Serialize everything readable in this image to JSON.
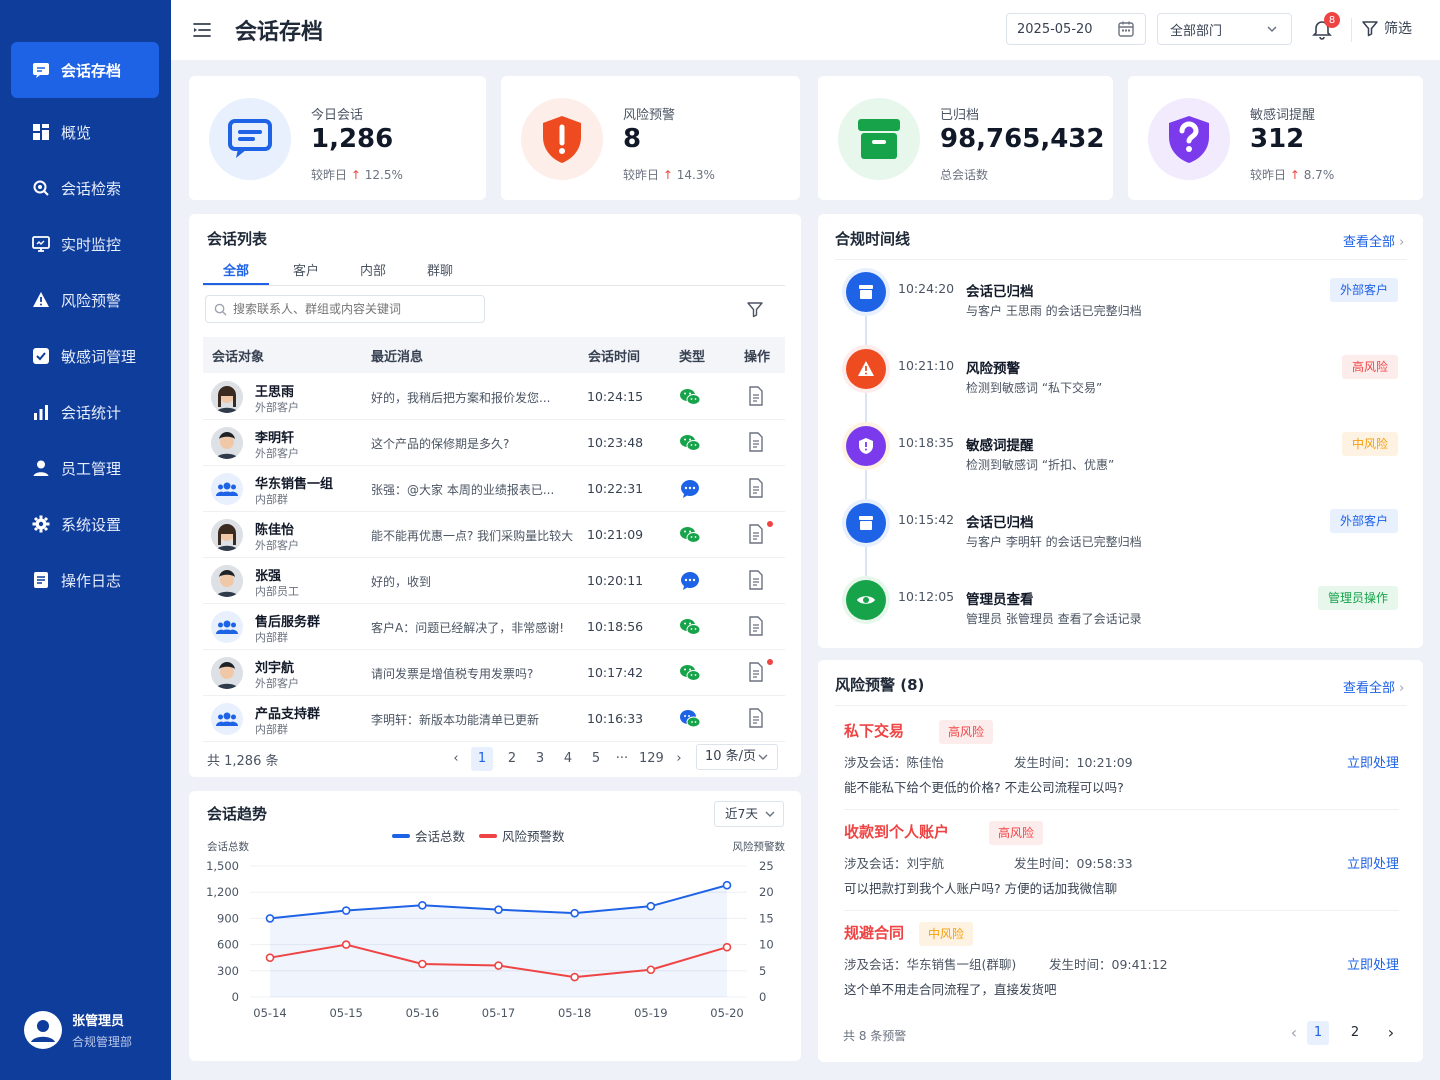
{
  "app": {
    "title": "会话存档"
  },
  "sidebar": {
    "items": [
      {
        "label": "会话存档",
        "icon": "chat-icon"
      },
      {
        "label": "概览",
        "icon": "dashboard-icon"
      },
      {
        "label": "会话检索",
        "icon": "search-icon"
      },
      {
        "label": "实时监控",
        "icon": "monitor-icon"
      },
      {
        "label": "风险预警",
        "icon": "alert-icon"
      },
      {
        "label": "敏感词管理",
        "icon": "check-icon"
      },
      {
        "label": "会话统计",
        "icon": "bar-chart-icon"
      },
      {
        "label": "员工管理",
        "icon": "user-icon"
      },
      {
        "label": "系统设置",
        "icon": "gear-icon"
      },
      {
        "label": "操作日志",
        "icon": "log-icon"
      }
    ],
    "active": 0,
    "user": {
      "name": "张管理员",
      "dept": "合规管理部"
    }
  },
  "topbar": {
    "date": "2025-05-20",
    "dept": "全部部门",
    "notifications": "8",
    "filter_label": "筛选"
  },
  "stats": [
    {
      "label": "今日会话",
      "value": "1,286",
      "prefix": "较昨日",
      "change": "12.5%",
      "color": "#1e62e6",
      "bg": "#e8f0fe",
      "icon": "chat-icon"
    },
    {
      "label": "风险预警",
      "value": "8",
      "prefix": "较昨日",
      "change": "14.3%",
      "color": "#ef4b21",
      "bg": "#feeee9",
      "icon": "shield-alert-icon"
    },
    {
      "label": "已归档",
      "value": "98,765,432",
      "prefix": "总会话数",
      "change": "",
      "color": "#16a34a",
      "bg": "#e7f7ec",
      "icon": "archive-icon"
    },
    {
      "label": "敏感词提醒",
      "value": "312",
      "prefix": "较昨日",
      "change": "8.7%",
      "color": "#7c3aed",
      "bg": "#f1ebfd",
      "icon": "shield-warn-icon"
    }
  ],
  "session_list": {
    "title": "会话列表",
    "tabs": [
      "全部",
      "客户",
      "内部",
      "群聊"
    ],
    "search_placeholder": "搜索联系人、群组或内容关键词",
    "columns": [
      "会话对象",
      "最近消息",
      "会话时间",
      "类型",
      "操作"
    ],
    "rows": [
      {
        "name": "王思雨",
        "sub": "外部客户",
        "msg": "好的，我稍后把方案和报价发您...",
        "time": "10:24:15",
        "type": "wechat",
        "avatar": "female",
        "dot": false
      },
      {
        "name": "李明轩",
        "sub": "外部客户",
        "msg": "这个产品的保修期是多久?",
        "time": "10:23:48",
        "type": "wechat",
        "avatar": "male",
        "dot": false
      },
      {
        "name": "华东销售一组",
        "sub": "内部群",
        "msg": "张强：@大家 本周的业绩报表已...",
        "time": "10:22:31",
        "type": "internal",
        "avatar": "group",
        "dot": false
      },
      {
        "name": "陈佳怡",
        "sub": "外部客户",
        "msg": "能不能再优惠一点? 我们采购量比较大",
        "time": "10:21:09",
        "type": "wechat",
        "avatar": "female",
        "dot": true
      },
      {
        "name": "张强",
        "sub": "内部员工",
        "msg": "好的，收到",
        "time": "10:20:11",
        "type": "internal",
        "avatar": "male",
        "dot": false
      },
      {
        "name": "售后服务群",
        "sub": "内部群",
        "msg": "客户A：问题已经解决了，非常感谢!",
        "time": "10:18:56",
        "type": "wechat",
        "avatar": "group",
        "dot": false
      },
      {
        "name": "刘宇航",
        "sub": "外部客户",
        "msg": "请问发票是增值税专用发票吗?",
        "time": "10:17:42",
        "type": "wechat",
        "avatar": "male",
        "dot": true
      },
      {
        "name": "产品支持群",
        "sub": "内部群",
        "msg": "李明轩：新版本功能清单已更新",
        "time": "10:16:33",
        "type": "mixed",
        "avatar": "group",
        "dot": false
      }
    ],
    "total": "共 1,286 条",
    "pages": [
      "1",
      "2",
      "3",
      "4",
      "5",
      "···",
      "129"
    ],
    "current_page": "1",
    "page_size": "10 条/页"
  },
  "timeline": {
    "title": "合规时间线",
    "view_all": "查看全部",
    "items": [
      {
        "time": "10:24:20",
        "title": "会话已归档",
        "desc": "与客户 王思雨 的会话已完整归档",
        "tag": "外部客户",
        "color": "#1e62e6",
        "tag_bg": "#e8f0fe",
        "icon": "archive-icon"
      },
      {
        "time": "10:21:10",
        "title": "风险预警",
        "desc": "检测到敏感词 “私下交易”",
        "tag": "高风险",
        "color": "#ef4b21",
        "tag_bg": "#fdecec",
        "icon": "alert-icon"
      },
      {
        "time": "10:18:35",
        "title": "敏感词提醒",
        "desc": "检测到敏感词 “折扣、优惠”",
        "tag": "中风险",
        "color": "#7c3aed",
        "tag_bg": "#fef3e2",
        "icon": "shield-icon"
      },
      {
        "time": "10:15:42",
        "title": "会话已归档",
        "desc": "与客户 李明轩 的会话已完整归档",
        "tag": "外部客户",
        "color": "#1e62e6",
        "tag_bg": "#e8f0fe",
        "icon": "archive-icon"
      },
      {
        "time": "10:12:05",
        "title": "管理员查看",
        "desc": "管理员 张管理员 查看了会话记录",
        "tag": "管理员操作",
        "color": "#16a34a",
        "tag_bg": "#e7f7ec",
        "icon": "eye-icon"
      }
    ]
  },
  "risk_alerts": {
    "title": "风险预警 (8)",
    "view_all": "查看全部",
    "items": [
      {
        "title": "私下交易",
        "level": "高风险",
        "session_label": "涉及会话：陈佳怡",
        "time_label": "发生时间：10:21:09",
        "content": "能不能私下给个更低的价格? 不走公司流程可以吗?",
        "action": "立即处理"
      },
      {
        "title": "收款到个人账户",
        "level": "高风险",
        "session_label": "涉及会话：刘宇航",
        "time_label": "发生时间：09:58:33",
        "content": "可以把款打到我个人账户吗? 方便的话加我微信聊",
        "action": "立即处理"
      },
      {
        "title": "规避合同",
        "level": "中风险",
        "session_label": "涉及会话：华东销售一组(群聊)",
        "time_label": "发生时间：09:41:12",
        "content": "这个单不用走合同流程了，直接发货吧",
        "action": "立即处理"
      }
    ],
    "footer": "共 8 条预警",
    "pages": [
      "1",
      "2"
    ],
    "current_page": "1"
  },
  "trend": {
    "title": "会话趋势",
    "range": "近7天",
    "chart_data": {
      "type": "line",
      "x": [
        "05-14",
        "05-15",
        "05-16",
        "05-17",
        "05-18",
        "05-19",
        "05-20"
      ],
      "series": [
        {
          "name": "会话总数",
          "values": [
            900,
            990,
            1050,
            1000,
            960,
            1040,
            1280
          ],
          "axis": "left",
          "color": "#1e62e6"
        },
        {
          "name": "风险预警数",
          "values": [
            7.5,
            10,
            6.3,
            6,
            3.8,
            5.2,
            9.5
          ],
          "axis": "right",
          "color": "#ef4444"
        }
      ],
      "ylabel_left": "会话总数",
      "ylabel_right": "风险预警数",
      "ylim_left": [
        0,
        1500
      ],
      "ylim_right": [
        0,
        25
      ],
      "yticks_left": [
        "0",
        "300",
        "600",
        "900",
        "1,200",
        "1,500"
      ],
      "yticks_right": [
        "0",
        "5",
        "10",
        "15",
        "20",
        "25"
      ],
      "legend": "top-center",
      "grid": true
    }
  }
}
